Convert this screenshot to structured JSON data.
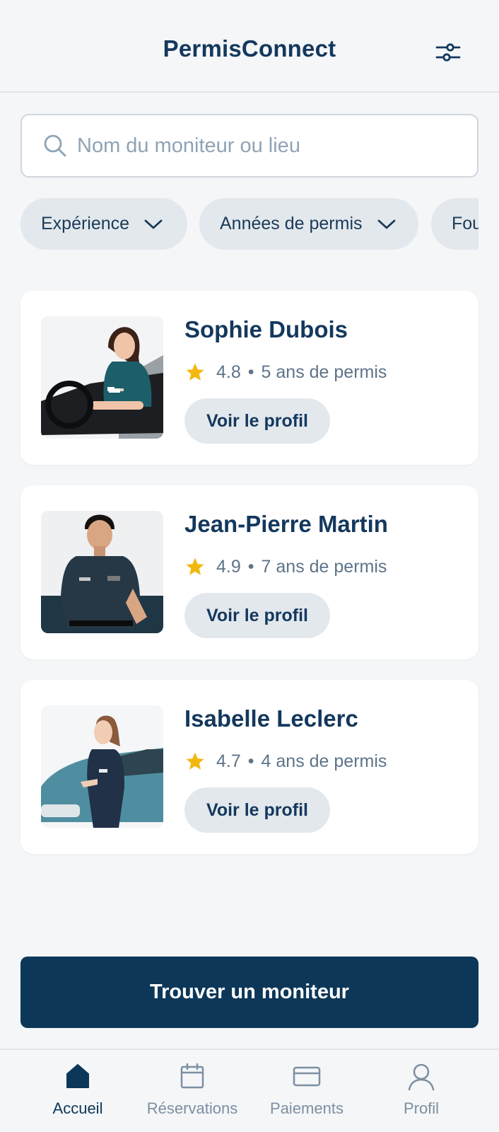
{
  "header": {
    "title": "PermisConnect",
    "filter_icon": "sliders-icon"
  },
  "search": {
    "placeholder": "Nom du moniteur ou lieu",
    "value": "",
    "icon": "search-icon"
  },
  "filters": [
    {
      "label": "Expérience"
    },
    {
      "label": "Années de permis"
    },
    {
      "label": "Fou"
    }
  ],
  "instructors": [
    {
      "name": "Sophie Dubois",
      "rating": "4.8",
      "separator": "•",
      "years": "5 ans de permis",
      "button": "Voir le profil"
    },
    {
      "name": "Jean-Pierre Martin",
      "rating": "4.9",
      "separator": "•",
      "years": "7 ans de permis",
      "button": "Voir le profil"
    },
    {
      "name": "Isabelle Leclerc",
      "rating": "4.7",
      "separator": "•",
      "years": "4 ans de permis",
      "button": "Voir le profil"
    }
  ],
  "cta": {
    "label": "Trouver un moniteur"
  },
  "bottom_nav": [
    {
      "label": "Accueil",
      "icon": "home-icon",
      "active": true
    },
    {
      "label": "Réservations",
      "icon": "calendar-icon",
      "active": false
    },
    {
      "label": "Paiements",
      "icon": "card-icon",
      "active": false
    },
    {
      "label": "Profil",
      "icon": "user-icon",
      "active": false
    }
  ],
  "colors": {
    "primary": "#0c3758",
    "background": "#f4f6f8",
    "chip": "#e3e8ed",
    "star": "#f2b80f",
    "muted_text": "#5e7489"
  }
}
